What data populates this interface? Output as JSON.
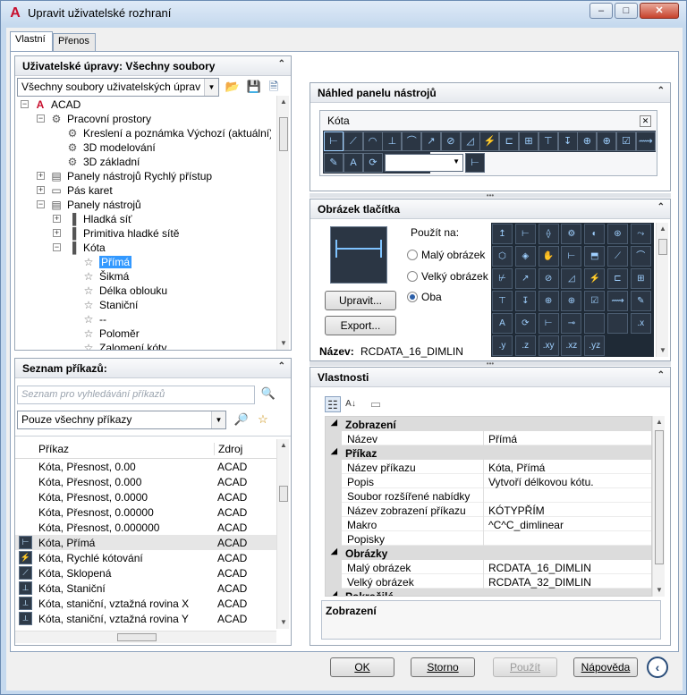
{
  "window": {
    "title": "Upravit uživatelské rozhraní",
    "app_icon": "A"
  },
  "tabs": [
    "Vlastní",
    "Přenos"
  ],
  "cust_panel": {
    "title": "Uživatelské úpravy: Všechny soubory",
    "combo_value": "Všechny soubory uživatelských úprav",
    "tree": [
      {
        "label": "ACAD",
        "expander": "−"
      },
      {
        "label": "Pracovní prostory",
        "expander": "−"
      },
      {
        "label": "Kreslení a poznámka Výchozí (aktuální)",
        "expander": ""
      },
      {
        "label": "3D modelování",
        "expander": ""
      },
      {
        "label": "3D základní",
        "expander": ""
      },
      {
        "label": "Panely nástrojů Rychlý přístup",
        "expander": "+"
      },
      {
        "label": "Pás karet",
        "expander": "+"
      },
      {
        "label": "Panely nástrojů",
        "expander": "−"
      },
      {
        "label": "Hladká síť",
        "expander": "+"
      },
      {
        "label": "Primitiva hladké sítě",
        "expander": "+"
      },
      {
        "label": "Kóta",
        "expander": "−"
      },
      {
        "label": "Přímá",
        "expander": ""
      },
      {
        "label": "Šikmá",
        "expander": ""
      },
      {
        "label": "Délka oblouku",
        "expander": ""
      },
      {
        "label": "Staniční",
        "expander": ""
      },
      {
        "label": "--",
        "expander": ""
      },
      {
        "label": "Poloměr",
        "expander": ""
      },
      {
        "label": "Zalomení kóty",
        "expander": ""
      }
    ]
  },
  "cmd_panel": {
    "title": "Seznam příkazů:",
    "search_placeholder": "Seznam pro vyhledávání příkazů",
    "filter_value": "Pouze všechny příkazy",
    "col_command": "Příkaz",
    "col_source": "Zdroj",
    "rows": [
      {
        "name": "Kóta, Přesnost, 0.00",
        "source": "ACAD"
      },
      {
        "name": "Kóta, Přesnost, 0.000",
        "source": "ACAD"
      },
      {
        "name": "Kóta, Přesnost, 0.0000",
        "source": "ACAD"
      },
      {
        "name": "Kóta, Přesnost, 0.00000",
        "source": "ACAD"
      },
      {
        "name": "Kóta, Přesnost, 0.000000",
        "source": "ACAD"
      },
      {
        "name": "Kóta, Přímá",
        "source": "ACAD"
      },
      {
        "name": "Kóta, Rychlé kótování",
        "source": "ACAD"
      },
      {
        "name": "Kóta, Sklopená",
        "source": "ACAD"
      },
      {
        "name": "Kóta, Staniční",
        "source": "ACAD"
      },
      {
        "name": "Kóta, staniční, vztažná rovina X",
        "source": "ACAD"
      },
      {
        "name": "Kóta, staniční, vztažná rovina Y",
        "source": "ACAD"
      }
    ]
  },
  "preview_panel": {
    "title": "Náhled panelu nástrojů",
    "toolbar_title": "Kóta"
  },
  "image_panel": {
    "title": "Obrázek tlačítka",
    "apply_to": "Použít na:",
    "opt_small": "Malý obrázek",
    "opt_large": "Velký obrázek",
    "opt_both": "Oba",
    "edit_button": "Upravit...",
    "export_button": "Export...",
    "name_label": "Název:",
    "name_value": "RCDATA_16_DIMLIN",
    "grid_labels": [
      ".x",
      ".y",
      ".z",
      ".xy",
      ".xz",
      ".yz"
    ]
  },
  "props_panel": {
    "title": "Vlastnosti",
    "categories": [
      {
        "name": "Zobrazení",
        "rows": [
          {
            "k": "Název",
            "v": "Přímá"
          }
        ]
      },
      {
        "name": "Příkaz",
        "rows": [
          {
            "k": "Název příkazu",
            "v": "Kóta, Přímá"
          },
          {
            "k": "Popis",
            "v": "Vytvoří délkovou kótu."
          },
          {
            "k": "Soubor rozšířené nabídky",
            "v": ""
          },
          {
            "k": "Název zobrazení příkazu",
            "v": "KÓTYPŘÍM"
          },
          {
            "k": "Makro",
            "v": "^C^C_dimlinear"
          },
          {
            "k": "Popisky",
            "v": ""
          }
        ]
      },
      {
        "name": "Obrázky",
        "rows": [
          {
            "k": "Malý obrázek",
            "v": "RCDATA_16_DIMLIN"
          },
          {
            "k": "Velký obrázek",
            "v": "RCDATA_32_DIMLIN"
          }
        ]
      },
      {
        "name": "Pokročilé",
        "rows": []
      }
    ],
    "desc_title": "Zobrazení"
  },
  "buttons": {
    "ok": "OK",
    "cancel": "Storno",
    "apply": "Použít",
    "help": "Nápověda"
  },
  "colors": {
    "accent": "#3399ff",
    "icon_bg": "#2b3644",
    "icon_fg": "#9fd0ff",
    "logo": "#c8102e"
  }
}
